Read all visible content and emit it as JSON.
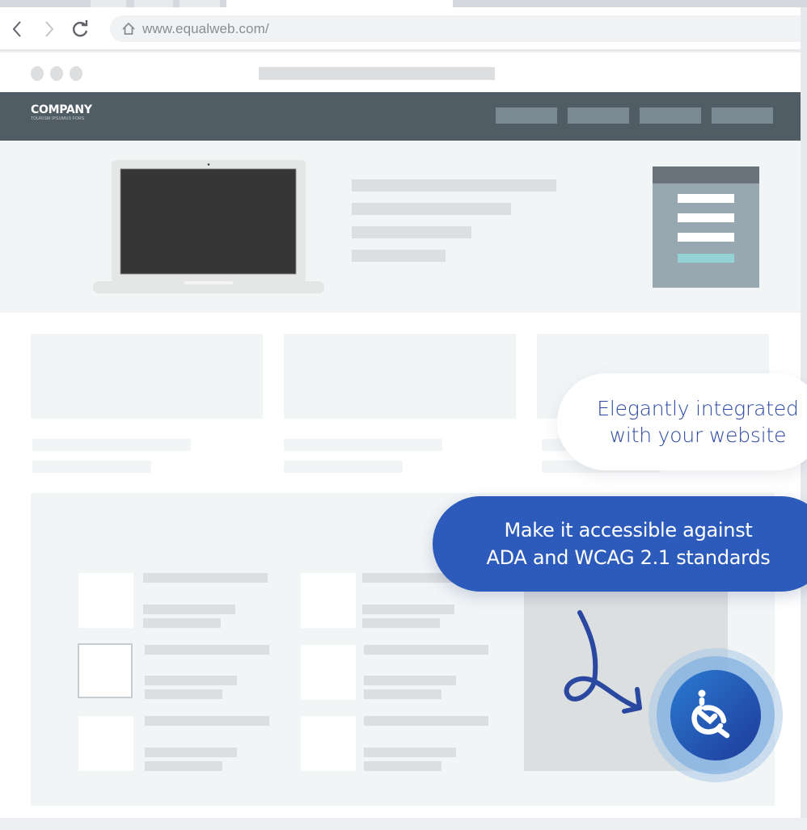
{
  "browser": {
    "url": "www.equalweb.com/",
    "icons": {
      "back": "chevron-left-icon",
      "forward": "chevron-right-icon",
      "reload": "reload-icon",
      "home": "home-icon"
    }
  },
  "site": {
    "logo_name": "COMPANY",
    "logo_tagline": "TOURISM IPSUMUS FORS",
    "nav_links_count": 4
  },
  "callouts": {
    "integrated": {
      "line1": "Elegantly integrated",
      "line2": "with your website"
    },
    "accessible": {
      "line1": "Make it accessible against",
      "line2": "ADA and WCAG 2.1 standards"
    }
  },
  "widget": {
    "icon": "accessibility-wheelchair-icon",
    "label": "Accessibility menu"
  },
  "colors": {
    "brand_blue": "#2d5bbb",
    "text_blue": "#2b48a1",
    "nav_dark": "#515d64",
    "screen_dark": "#363636",
    "accent_teal": "#93d3d6"
  }
}
